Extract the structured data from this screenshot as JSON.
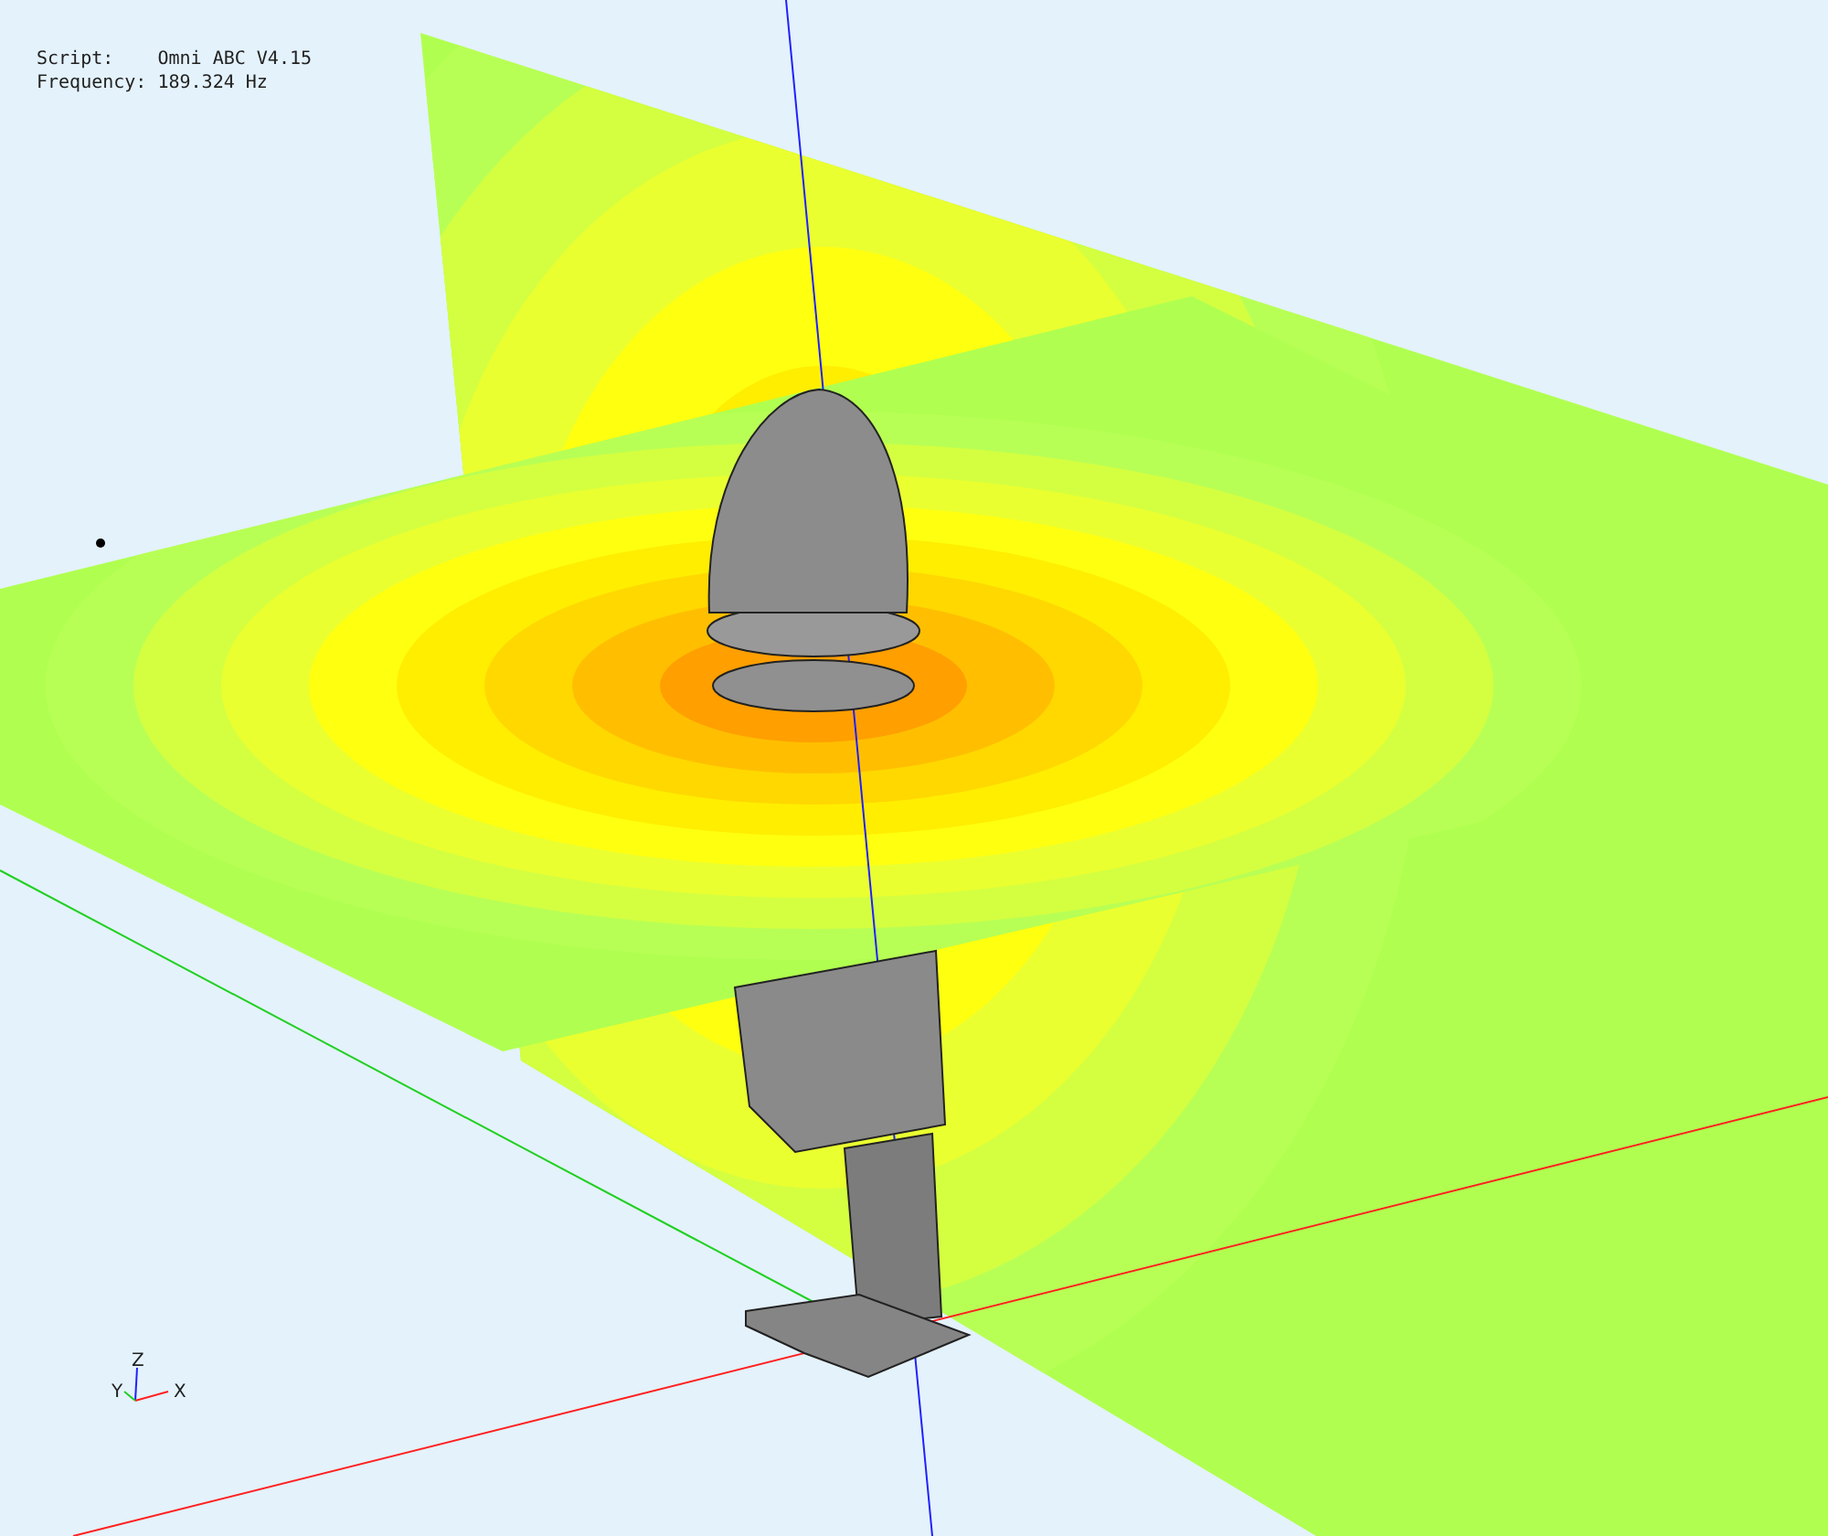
{
  "info": [
    {
      "label": "Script:",
      "value": "Omni ABC V4.15"
    },
    {
      "label": "Frequency:",
      "value": "189.324 Hz"
    }
  ],
  "axis_triad": {
    "z": "Z",
    "y": "Y",
    "x": "X"
  }
}
